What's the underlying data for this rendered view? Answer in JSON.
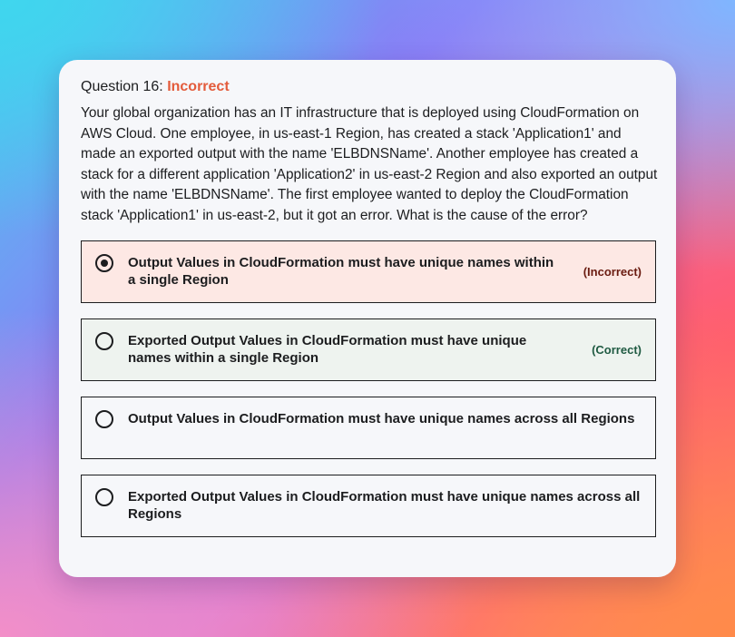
{
  "question": {
    "label": "Question 16:",
    "status": "Incorrect",
    "text": "Your global organization has an IT infrastructure that is deployed using CloudFormation on AWS Cloud. One employee, in us-east-1 Region, has created a stack 'Application1' and made an exported output with the name 'ELBDNSName'. Another employee has created a stack for a different application 'Application2' in us-east-2 Region and also exported an output with the name 'ELBDNSName'. The first employee wanted to deploy the CloudFormation stack 'Application1' in us-east-2, but it got an error. What is the cause of the error?"
  },
  "options": [
    {
      "text": "Output Values in CloudFormation must have unique names within a single Region",
      "tag": "(Incorrect)",
      "selected": true
    },
    {
      "text": "Exported Output Values in CloudFormation must have unique names within a single Region",
      "tag": "(Correct)",
      "selected": false
    },
    {
      "text": "Output Values in CloudFormation must have unique names across all Regions",
      "tag": "",
      "selected": false
    },
    {
      "text": "Exported Output Values in CloudFormation must have unique names across all Regions",
      "tag": "",
      "selected": false
    }
  ],
  "colors": {
    "status_incorrect": "#e35b3b",
    "incorrect_bg": "#fde8e4",
    "correct_bg": "#eef3ef",
    "incorrect_tag": "#6a1b10",
    "correct_tag": "#1f5a42"
  }
}
